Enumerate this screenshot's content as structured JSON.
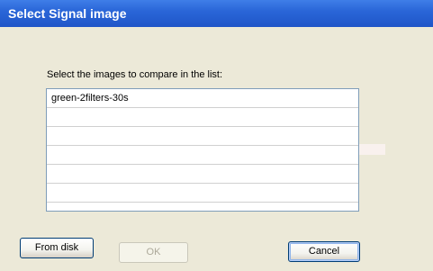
{
  "dialog": {
    "title": "Select Signal image",
    "instruction": "Select the images to compare in the list:"
  },
  "list": {
    "items": [
      "green-2filters-30s",
      "",
      "",
      "",
      "",
      ""
    ]
  },
  "buttons": {
    "from_disk": "From disk",
    "ok": "OK",
    "cancel": "Cancel"
  },
  "colors": {
    "titlebar": "#2a66d8",
    "dialog_bg": "#ece9d8",
    "list_border": "#7f9db9"
  }
}
